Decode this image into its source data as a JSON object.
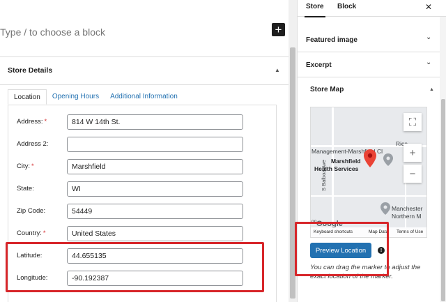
{
  "editor": {
    "placeholder": "Type / to choose a block",
    "inserter_symbol": "+"
  },
  "metabox": {
    "title": "Store Details",
    "toggle_symbol": "▲",
    "tabs": [
      {
        "label": "Location",
        "active": true
      },
      {
        "label": "Opening Hours",
        "active": false
      },
      {
        "label": "Additional Information",
        "active": false
      }
    ],
    "fields": [
      {
        "label": "Address:",
        "required": true,
        "value": "814 W 14th St."
      },
      {
        "label": "Address 2:",
        "required": false,
        "value": ""
      },
      {
        "label": "City:",
        "required": true,
        "value": "Marshfield"
      },
      {
        "label": "State:",
        "required": false,
        "value": "WI"
      },
      {
        "label": "Zip Code:",
        "required": false,
        "value": "54449"
      },
      {
        "label": "Country:",
        "required": true,
        "value": "United States"
      },
      {
        "label": "Latitude:",
        "required": false,
        "value": "44.655135"
      },
      {
        "label": "Longitude:",
        "required": false,
        "value": "-90.192387"
      }
    ],
    "required_mark": "*"
  },
  "sidebar": {
    "tabs": [
      {
        "label": "Store",
        "active": true
      },
      {
        "label": "Block",
        "active": false
      }
    ],
    "close_symbol": "✕",
    "panels": [
      {
        "label": "Featured image",
        "chevron": "⌄"
      },
      {
        "label": "Excerpt",
        "chevron": "⌄"
      }
    ],
    "store_map": {
      "title": "Store Map",
      "toggle_symbol": "▲",
      "map_labels": {
        "rice": "Rice",
        "management": "Management-Marshfield Cl",
        "marshfield": "Marshfield",
        "health_services": "Health Services",
        "balboa": "S Balboa Ave",
        "manchester": "Manchester",
        "northern": "Northern M",
        "google": "Google",
        "oo": "oo"
      },
      "footer": {
        "shortcuts": "Keyboard shortcuts",
        "map_data": "Map Data",
        "terms": "Terms of Use"
      },
      "buttons": {
        "fullscreen": "⛶",
        "zoom_in": "+",
        "zoom_out": "−"
      },
      "preview_label": "Preview Location",
      "info_symbol": "!",
      "help_text": "You can drag the marker to adjust the exact location of the marker."
    }
  },
  "colors": {
    "accent": "#2271b1",
    "required": "#d63638",
    "highlight": "#d7262a",
    "pin": "#ea4335"
  }
}
